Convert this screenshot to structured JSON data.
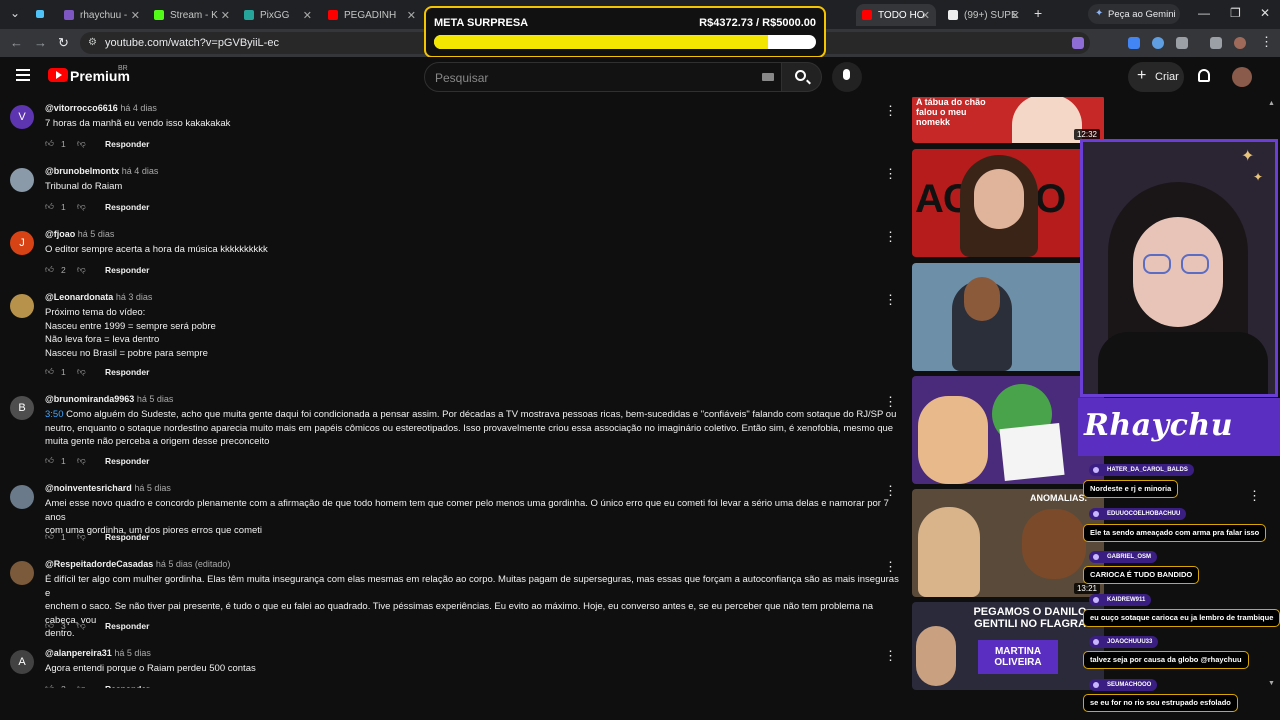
{
  "browser": {
    "tabs": [
      {
        "label": "rhaychuu -"
      },
      {
        "label": "Stream - K"
      },
      {
        "label": "PixGG"
      },
      {
        "label": "PEGADINH"
      },
      {
        "label": "TODO HO"
      },
      {
        "label": "(99+) SUPE"
      }
    ],
    "gemini_button": "Peça ao Gemini",
    "url": "youtube.com/watch?v=pGVByiiL-ec",
    "colors": {
      "tab_bar": "#202124",
      "active_tab": "#35363a",
      "toolbar": "#35363a"
    }
  },
  "goal_overlay": {
    "title": "META SURPRESA",
    "amount": "R$4372.73 / R$5000.00",
    "progress_fraction": 0.8745,
    "colors": {
      "border": "#f5c400",
      "fill": "#f3e600",
      "track": "#ffffff"
    }
  },
  "youtube_header": {
    "brand": "Premium",
    "region": "BR",
    "search_placeholder": "Pesquisar",
    "create_label": "Criar",
    "colors": {
      "logo": "#ff0000",
      "background": "#0f0f0f"
    }
  },
  "comments": [
    {
      "initial": "V",
      "avatar_color": "#5e35b1",
      "user": "@vitorrocco6616",
      "time": "há 4 dias",
      "lines": [
        "7 horas da manhã eu vendo isso kakakakak"
      ],
      "likes": "1"
    },
    {
      "initial": "",
      "avatar_color": "#8a9aa8",
      "user": "@brunobelmontx",
      "time": "há 4 dias",
      "lines": [
        "Tribunal do Raiam"
      ],
      "likes": "1"
    },
    {
      "initial": "J",
      "avatar_color": "#d84315",
      "user": "@fjoao",
      "time": "há 5 dias",
      "lines": [
        "O editor sempre acerta a hora da música kkkkkkkkkk"
      ],
      "likes": "2"
    },
    {
      "initial": "",
      "avatar_color": "#b7924a",
      "user": "@Leonardonata",
      "time": "há 3 dias",
      "lines": [
        "Próximo tema do vídeo:",
        "Nasceu entre 1999 = sempre será pobre",
        "Não leva fora = leva dentro",
        "Nasceu no Brasil = pobre para sempre"
      ],
      "likes": "1"
    },
    {
      "initial": "B",
      "avatar_color": "#4e4e4e",
      "user": "@brunomiranda9963",
      "time": "há 5 dias",
      "timestamp_link": "3:50",
      "lines": [
        "Como alguém do Sudeste, acho que muita gente daqui foi condicionada a pensar assim. Por décadas a TV mostrava pessoas ricas, bem-sucedidas e \"confiáveis\" falando com sotaque do RJ/SP ou",
        "neutro, enquanto o sotaque nordestino aparecia muito mais em papéis cômicos ou estereotipados. Isso provavelmente criou essa associação no imaginário coletivo. Então sim, é xenofobia, mesmo que",
        "muita gente não perceba a origem desse preconceito"
      ],
      "likes": "1"
    },
    {
      "initial": "",
      "avatar_color": "#6a7a8a",
      "user": "@noinventesrichard",
      "time": "há 5 dias",
      "lines": [
        "Amei esse novo quadro e concordo plenamente com a afirmação de que todo homem tem que comer pelo menos uma gordinha. O único erro que eu cometi foi levar a sério uma delas e namorar por 7 anos",
        "com uma gordinha, um dos piores erros que cometi"
      ],
      "likes": "1"
    },
    {
      "initial": "",
      "avatar_color": "#7a5a3a",
      "user": "@RespeitadordeCasadas",
      "time": "há 5 dias (editado)",
      "lines": [
        "É difícil ter algo com mulher gordinha. Elas têm muita insegurança com elas mesmas em relação ao corpo. Muitas pagam de superseguras, mas essas que forçam a autoconfiança são as mais inseguras e",
        "enchem o saco. Se não tiver pai presente, é tudo o que eu falei ao quadrado. Tive péssimas experiências. Eu evito ao máximo. Hoje, eu converso antes e, se eu perceber que não tem problema na cabeça, vou",
        "dentro."
      ],
      "likes": "3"
    },
    {
      "initial": "A",
      "avatar_color": "#424242",
      "user": "@alanpereira31",
      "time": "há 5 dias",
      "lines": [
        "Agora entendi porque o Raiam perdeu 500 contas"
      ],
      "likes": "2"
    }
  ],
  "reply_label": "Responder",
  "thumbnails": [
    {
      "text": "A tábua do chão falou o meu nomekk",
      "duration": "12:32",
      "bg": "#c62828"
    },
    {
      "text": "ACA BO",
      "duration": "",
      "bg": "#b71c1c"
    },
    {
      "text": "",
      "duration": "",
      "bg": "#6d8fa8"
    },
    {
      "text": "",
      "duration": "",
      "bg": "#4a2a7a"
    },
    {
      "text": "ANOMALIAS.",
      "duration": "13:21",
      "bg": "#5a4a3a"
    },
    {
      "text": "PEGAMOS O DANILO GENTILI NO FLAGRA",
      "subtext": "MARTINA OLIVEIRA",
      "duration": "",
      "bg": "#2a2a3a"
    }
  ],
  "stream": {
    "name": "Rhaychu",
    "colors": {
      "frame": "#6b3fd6",
      "banner": "#5a2ec0",
      "chat_border": "#d8a600"
    }
  },
  "chat": [
    {
      "user": "HATER_DA_CAROL_BALDS",
      "text": "Nordeste e rj e minoria"
    },
    {
      "user": "EDUUOCOELHOBACHUU",
      "text": "Ele ta sendo ameaçado com arma pra falar isso"
    },
    {
      "user": "GABRIEL_OSM",
      "text": "CARIOCA É TUDO BANDIDO"
    },
    {
      "user": "KAIDREW911",
      "text": "eu ouço sotaque carioca eu ja lembro de trambique"
    },
    {
      "user": "JOAOCHUUU33",
      "text": "talvez seja por causa da globo @rhaychuu"
    },
    {
      "user": "SEUMACHOOO",
      "text": "se eu for no rio sou estrupado esfolado"
    }
  ]
}
